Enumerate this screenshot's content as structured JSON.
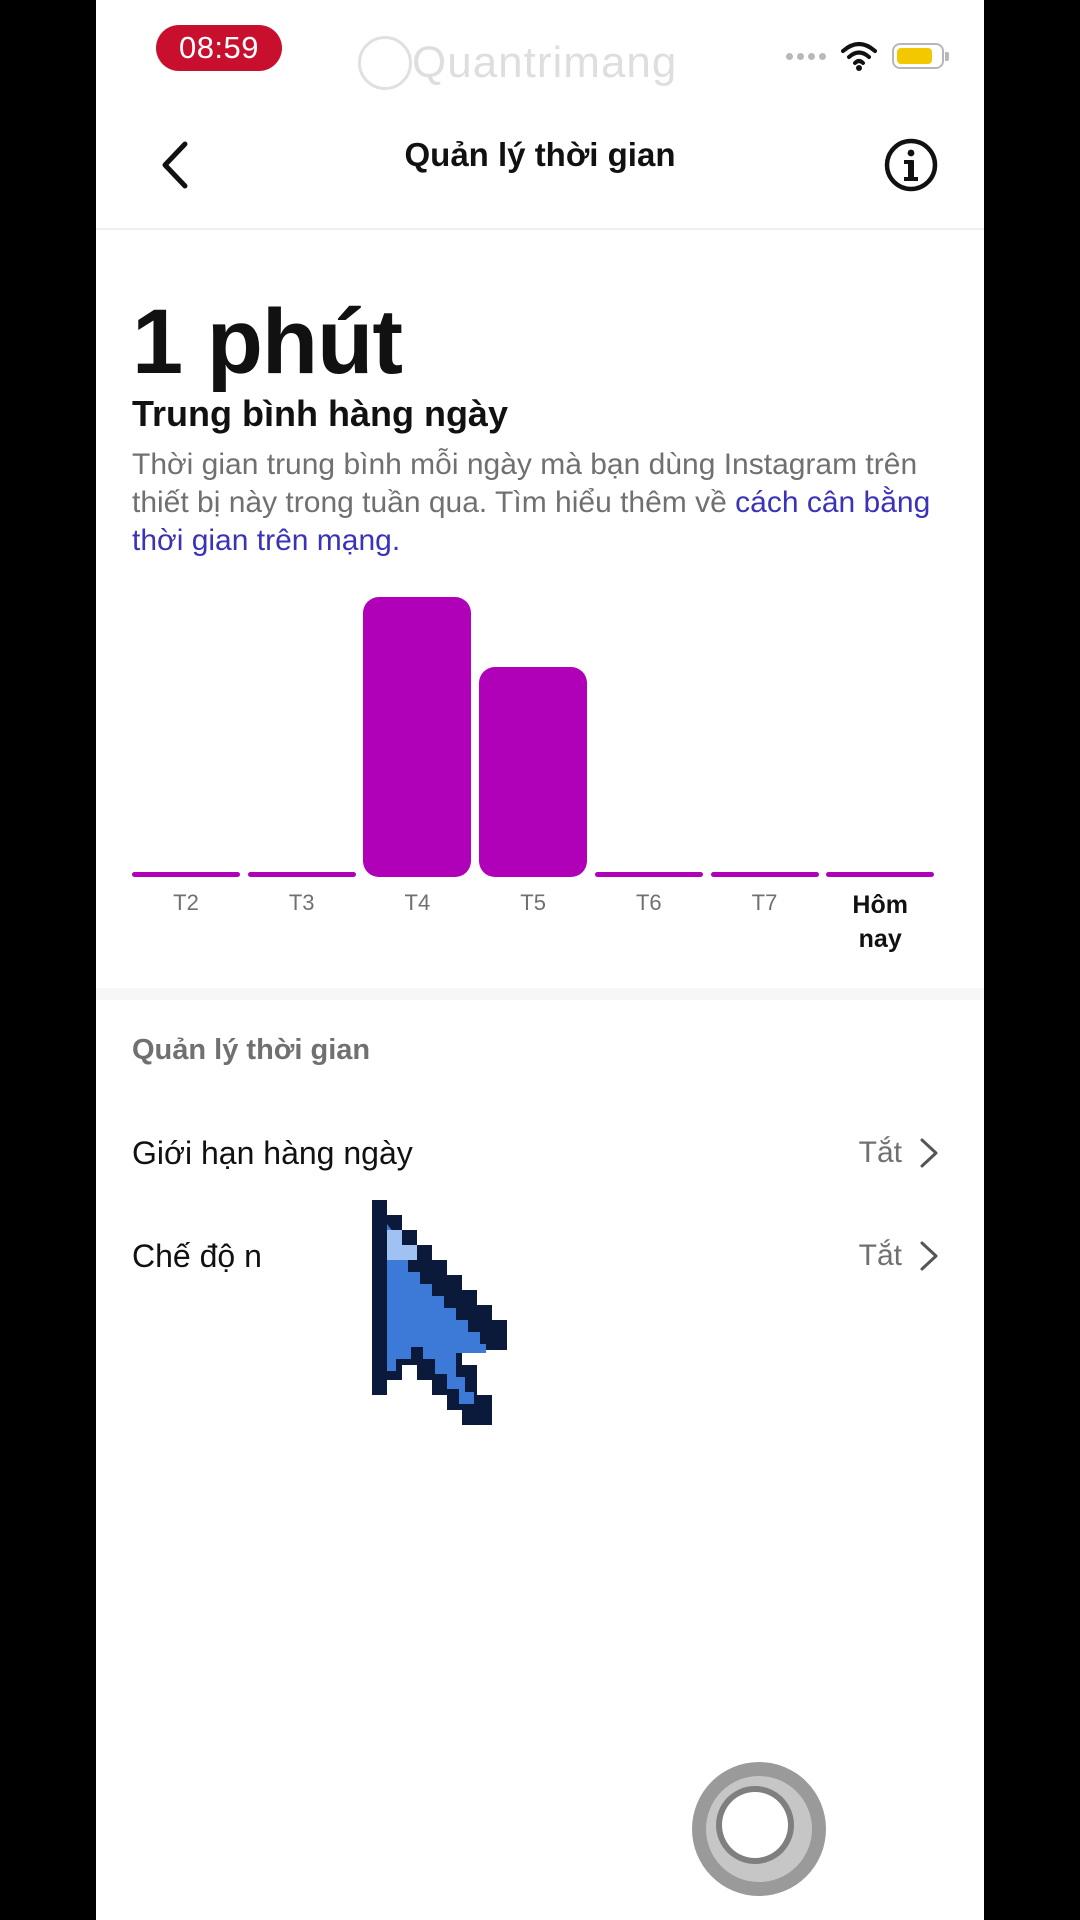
{
  "status_bar": {
    "time": "08:59",
    "watermark": "Quantrimang",
    "battery_level": 0.75,
    "battery_color": "#f4c800"
  },
  "header": {
    "title": "Quản lý thời gian",
    "back_icon": "chevron-left-icon",
    "info_icon": "info-icon"
  },
  "summary": {
    "value": "1 phút",
    "label": "Trung bình hàng ngày",
    "description": "Thời gian trung bình mỗi ngày mà bạn dùng Instagram trên thiết bị này trong tuần qua. Tìm hiểu thêm về ",
    "link_text": "cách cân bằng thời gian trên mạng",
    "description_end": "."
  },
  "chart_data": {
    "type": "bar",
    "categories": [
      "T2",
      "T3",
      "T4",
      "T5",
      "T6",
      "T7",
      "Hôm nay"
    ],
    "values": [
      0,
      0,
      1.0,
      0.75,
      0,
      0,
      0
    ],
    "highlight": "Hôm nay",
    "bar_color": "#b000b8",
    "ylim": [
      0,
      1
    ]
  },
  "chart_labels": {
    "today_line1": "Hôm",
    "today_line2": "nay"
  },
  "settings": {
    "section_title": "Quản lý thời gian",
    "rows": [
      {
        "label": "Giới hạn hàng ngày",
        "value": "Tắt"
      },
      {
        "label": "Chế độ n",
        "value": "Tắt"
      }
    ]
  },
  "colors": {
    "accent": "#b000b8",
    "link": "#3a33b8",
    "status_time_bg": "#c8102e"
  }
}
